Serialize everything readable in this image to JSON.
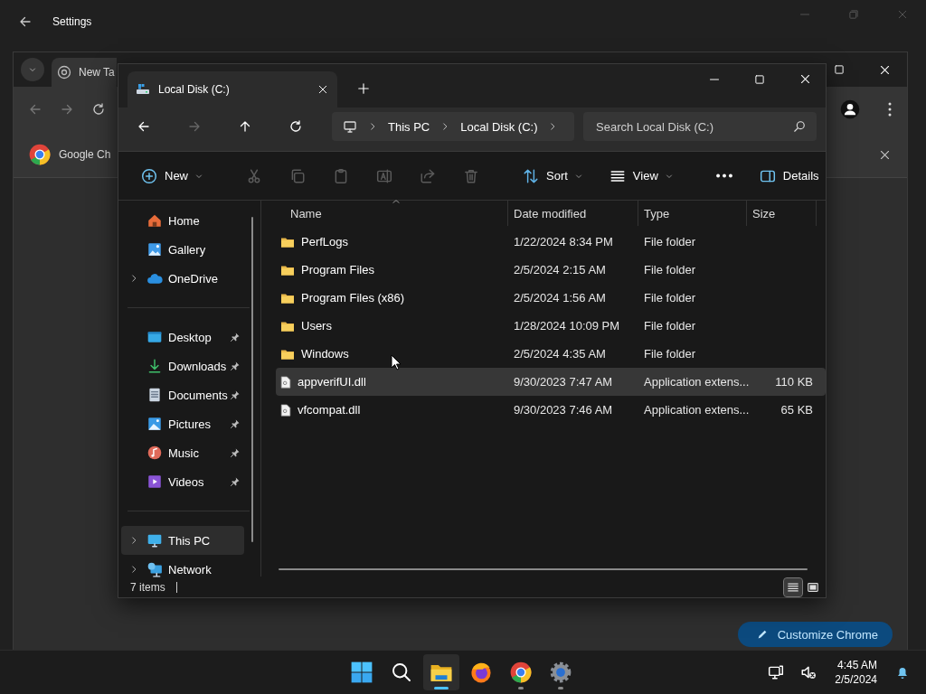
{
  "settings_window": {
    "title": "Settings"
  },
  "browser_window": {
    "tab": {
      "title": "New Ta"
    },
    "bookmarks": [
      {
        "label": "Google Ch"
      }
    ],
    "customize_button": "Customize Chrome"
  },
  "explorer": {
    "tab": {
      "title": "Local Disk (C:)"
    },
    "breadcrumb": [
      "This PC",
      "Local Disk (C:)"
    ],
    "search": {
      "placeholder": "Search Local Disk (C:)"
    },
    "toolbar": [
      {
        "kind": "menu",
        "label": "New",
        "disabled": false
      },
      {
        "kind": "separator"
      },
      {
        "kind": "icon",
        "disabled": true
      },
      {
        "kind": "icon",
        "disabled": true
      },
      {
        "kind": "icon",
        "disabled": true
      },
      {
        "kind": "icon",
        "disabled": true
      },
      {
        "kind": "icon",
        "disabled": true
      },
      {
        "kind": "icon",
        "disabled": true
      },
      {
        "kind": "separator"
      },
      {
        "kind": "menu",
        "label": "Sort",
        "disabled": false
      },
      {
        "kind": "menu",
        "label": "View",
        "disabled": false
      },
      {
        "kind": "separator"
      },
      {
        "kind": "icon",
        "disabled": false
      }
    ],
    "details_button": "Details",
    "sidebar": {
      "sections": [
        {
          "items": [
            {
              "label": "Home",
              "expandable": false,
              "pinned": false,
              "selected": false
            },
            {
              "label": "Gallery",
              "expandable": false,
              "pinned": false,
              "selected": false
            },
            {
              "label": "OneDrive",
              "expandable": true,
              "pinned": false,
              "selected": false
            }
          ]
        },
        {
          "items": [
            {
              "label": "Desktop",
              "expandable": false,
              "pinned": true,
              "selected": false
            },
            {
              "label": "Downloads",
              "expandable": false,
              "pinned": true,
              "selected": false
            },
            {
              "label": "Documents",
              "expandable": false,
              "pinned": true,
              "selected": false
            },
            {
              "label": "Pictures",
              "expandable": false,
              "pinned": true,
              "selected": false
            },
            {
              "label": "Music",
              "expandable": false,
              "pinned": true,
              "selected": false
            },
            {
              "label": "Videos",
              "expandable": false,
              "pinned": true,
              "selected": false
            }
          ]
        },
        {
          "items": [
            {
              "label": "This PC",
              "expandable": true,
              "pinned": false,
              "selected": true
            },
            {
              "label": "Network",
              "expandable": true,
              "pinned": false,
              "selected": false
            }
          ]
        }
      ]
    },
    "columns": [
      {
        "label": "Name",
        "sorted": true
      },
      {
        "label": "Date modified",
        "sorted": false
      },
      {
        "label": "Type",
        "sorted": false
      },
      {
        "label": "Size",
        "sorted": false
      }
    ],
    "rows": [
      {
        "kind": "folder",
        "name": "PerfLogs",
        "date": "1/22/2024 8:34 PM",
        "type": "File folder",
        "selected": false
      },
      {
        "kind": "folder",
        "name": "Program Files",
        "date": "2/5/2024 2:15 AM",
        "type": "File folder",
        "selected": false
      },
      {
        "kind": "folder",
        "name": "Program Files (x86)",
        "date": "2/5/2024 1:56 AM",
        "type": "File folder",
        "selected": false
      },
      {
        "kind": "folder",
        "name": "Users",
        "date": "1/28/2024 10:09 PM",
        "type": "File folder",
        "selected": false
      },
      {
        "kind": "folder",
        "name": "Windows",
        "date": "2/5/2024 4:35 AM",
        "type": "File folder",
        "selected": false
      },
      {
        "kind": "file",
        "name": "appverifUI.dll",
        "date": "9/30/2023 7:47 AM",
        "type": "Application extens...",
        "size": "110 KB",
        "selected": true
      },
      {
        "kind": "file",
        "name": "vfcompat.dll",
        "date": "9/30/2023 7:46 AM",
        "type": "Application extens...",
        "size": "65 KB",
        "selected": false
      }
    ],
    "status": {
      "count": "7 items"
    },
    "views": [
      {
        "selected": true
      },
      {
        "selected": false
      }
    ]
  },
  "taskbar": {
    "apps": [
      {
        "running": false,
        "active": false
      },
      {
        "running": false,
        "active": false
      },
      {
        "running": true,
        "active": true
      },
      {
        "running": false,
        "active": false
      },
      {
        "running": true,
        "active": false
      },
      {
        "running": true,
        "active": false
      }
    ],
    "time": "4:45 AM",
    "date": "2/5/2024"
  }
}
